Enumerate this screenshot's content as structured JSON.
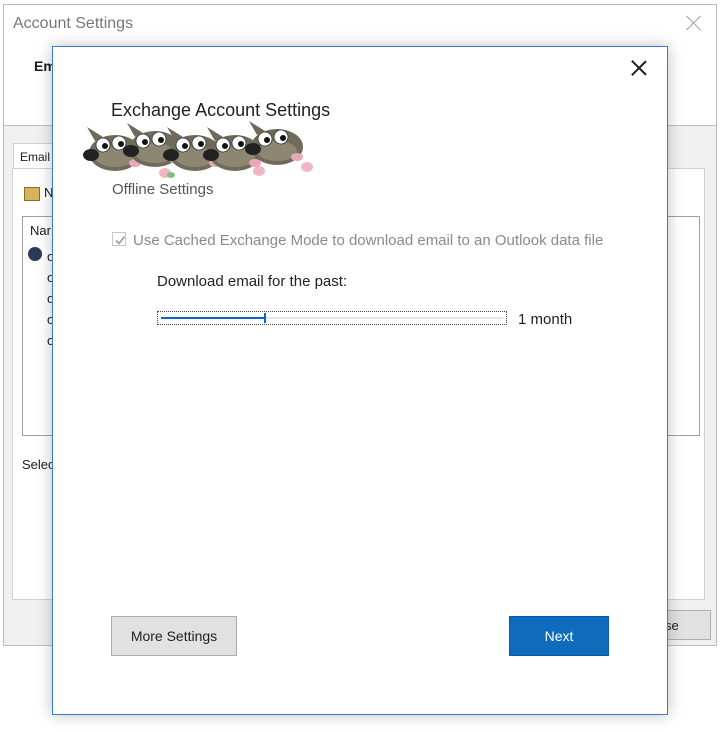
{
  "background_window": {
    "title": "Account Settings",
    "header_bold": "Em",
    "tab_label": "Email",
    "new_label": "N",
    "list_header": "Nar",
    "list_rows": [
      "o",
      "o",
      "o",
      "o",
      "o"
    ],
    "select_text": "Selec",
    "close_button_label": "se"
  },
  "dialog": {
    "title": "Exchange Account Settings",
    "section_label": "Offline Settings",
    "cached_mode": {
      "label": "Use Cached Exchange Mode to download email to an Outlook data file",
      "checked": true,
      "disabled": true
    },
    "download_label": "Download email for the past:",
    "slider": {
      "value_label": "1 month",
      "position_fraction": 0.3
    },
    "buttons": {
      "more_settings": "More Settings",
      "next": "Next"
    }
  },
  "colors": {
    "accent": "#0f6cbd",
    "dialog_border": "#3a7ccf",
    "slider_fill": "#0a64c8"
  },
  "icons": [
    "close-icon",
    "checkmark-icon",
    "gimp-mascot-icon",
    "account-icon"
  ]
}
